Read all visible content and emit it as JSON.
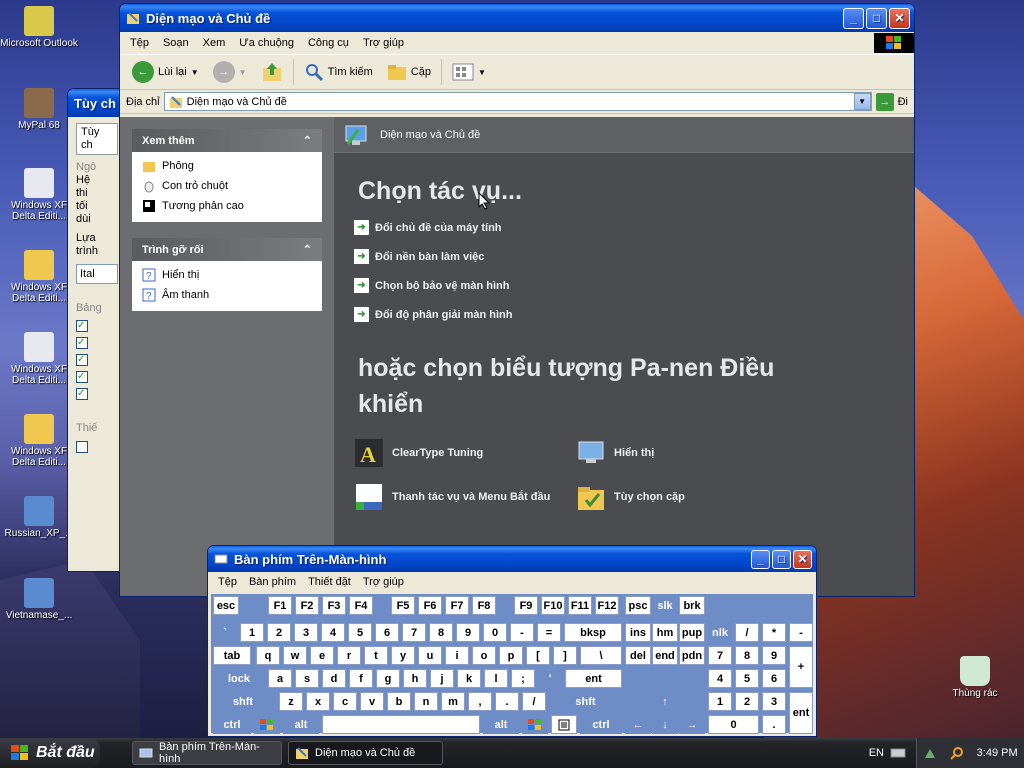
{
  "desktop": {
    "icons": [
      {
        "label": "Microsoft Outlook",
        "color": "#d8c94a"
      },
      {
        "label": "MyPal 68",
        "color": "#8a6a4a"
      },
      {
        "label": "Windows XF Delta Editi...",
        "color": "#e8e8f0"
      },
      {
        "label": "Windows XF Delta Editi...",
        "color": "#f0c850"
      },
      {
        "label": "Windows XF Delta Editi...",
        "color": "#e8e8f0"
      },
      {
        "label": "Windows XF Delta Editi...",
        "color": "#f0c850"
      },
      {
        "label": "Russian_XP_...",
        "color": "#5a8ad0"
      },
      {
        "label": "Vietnamase_...",
        "color": "#5a8ad0"
      }
    ],
    "recycle_bin": "Thùng rác"
  },
  "bgwin": {
    "title": "Tùy ch",
    "tab": "Tùy ch",
    "group1": "Ngô",
    "lines": [
      "Hệ",
      "thi",
      "tối",
      "dùi",
      "Lựa",
      "trình"
    ],
    "select": "Ital",
    "group2": "Bảng",
    "group3": "Thiế"
  },
  "explorer": {
    "title": "Diện mạo và Chủ đề",
    "menu": [
      "Tệp",
      "Soạn",
      "Xem",
      "Ưa chuộng",
      "Công cụ",
      "Trợ giúp"
    ],
    "toolbar": {
      "back": "Lùi lại",
      "search": "Tìm kiếm",
      "folders": "Cặp"
    },
    "address_label": "Địa chỉ",
    "address_value": "Diện mạo và Chủ đề",
    "go_label": "Đi",
    "see_also": {
      "title": "Xem thêm",
      "items": [
        "Phông",
        "Con trỏ chuột",
        "Tương phản cao"
      ]
    },
    "troubleshoot": {
      "title": "Trình gỡ rối",
      "items": [
        "Hiển thị",
        "Âm thanh"
      ]
    },
    "content_header": "Diện mạo và Chủ đề",
    "pick_task": "Chọn tác vụ...",
    "tasks": [
      "Đổi chủ đề của máy tính",
      "Đổi nền bàn làm việc",
      "Chọn bộ bảo vệ màn hình",
      "Đổi độ phân giải màn hình"
    ],
    "pick_icon": "hoặc chọn biểu tượng Pa-nen Điều khiển",
    "cpl": [
      "ClearType Tuning",
      "Hiển thị",
      "Thanh tác vụ và Menu Bắt đầu",
      "Tùy chọn cặp"
    ]
  },
  "osk": {
    "title": "Bàn phím Trên-Màn-hình",
    "menu": [
      "Tệp",
      "Bàn phím",
      "Thiết đặt",
      "Trợ giúp"
    ]
  },
  "taskbar": {
    "start": "Bắt đầu",
    "buttons": [
      "Bàn phím Trên-Màn-hình",
      "Diện mạo và Chủ đề"
    ],
    "lang": "EN",
    "time": "3:49 PM"
  }
}
